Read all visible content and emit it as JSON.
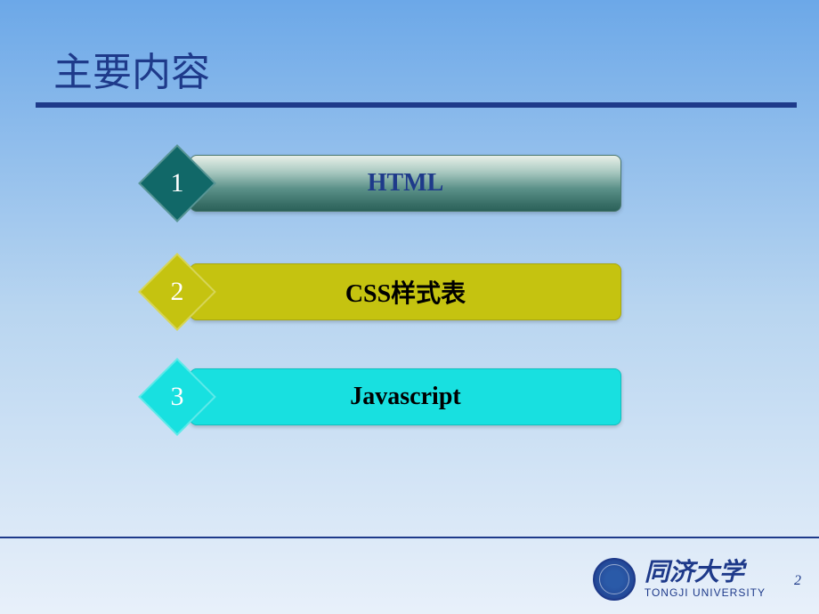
{
  "title": "主要内容",
  "items": [
    {
      "number": "1",
      "label": "HTML"
    },
    {
      "number": "2",
      "label": "CSS样式表"
    },
    {
      "number": "3",
      "label": "Javascript"
    }
  ],
  "footer": {
    "university_cn": "同济大学",
    "university_en": "TONGJI UNIVERSITY"
  },
  "page_number": "2"
}
